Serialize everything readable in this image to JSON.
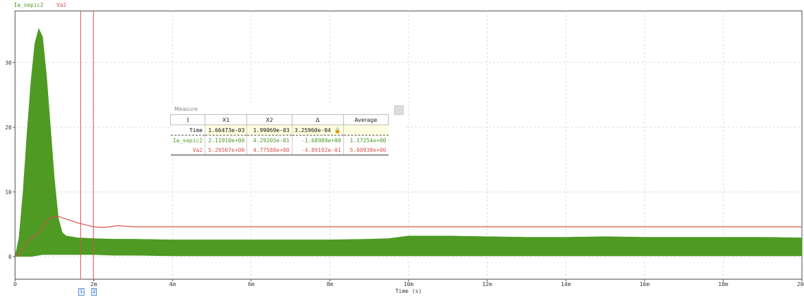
{
  "chart_data": {
    "type": "line",
    "xlabel": "Time (s)",
    "x_unit": "s",
    "xlim": [
      0,
      0.02
    ],
    "ylim": [
      -3.5,
      38
    ],
    "x_ticks": [
      0,
      0.002,
      0.004,
      0.006,
      0.008,
      0.01,
      0.012,
      0.014,
      0.016,
      0.018,
      0.02
    ],
    "x_tick_labels": [
      "0",
      "2m",
      "4m",
      "6m",
      "8m",
      "10m",
      "12m",
      "14m",
      "16m",
      "18m",
      "20m"
    ],
    "y_ticks": [
      0,
      10,
      20,
      30
    ],
    "y_tick_labels": [
      "0",
      "10",
      "20",
      "30"
    ],
    "grid": true,
    "legend_placement": "top-left",
    "series": [
      {
        "name": "Ia_sepic2",
        "color": "#4e9a23",
        "style": "high-frequency band (min/max envelope)",
        "x": [
          0,
          0.0001,
          0.0002,
          0.0003,
          0.0004,
          0.0005,
          0.0006,
          0.0007,
          0.0008,
          0.0009,
          0.001,
          0.0011,
          0.0012,
          0.0013,
          0.0016,
          0.002,
          0.0025,
          0.003,
          0.004,
          0.005,
          0.006,
          0.007,
          0.008,
          0.009,
          0.0095,
          0.01,
          0.011,
          0.012,
          0.013,
          0.014,
          0.015,
          0.016,
          0.017,
          0.018,
          0.019,
          0.02
        ],
        "upper": [
          0,
          3,
          10,
          19,
          27,
          33,
          35.3,
          34,
          28,
          20,
          12,
          6,
          3.7,
          3.2,
          2.9,
          2.8,
          2.7,
          2.7,
          2.6,
          2.6,
          2.6,
          2.6,
          2.6,
          2.7,
          2.8,
          3.2,
          3.2,
          3.1,
          3.0,
          3.0,
          3.1,
          3.0,
          3.0,
          3.0,
          3.0,
          2.9
        ],
        "lower": [
          0,
          0,
          0,
          0,
          0,
          0.1,
          0.2,
          0.3,
          0.3,
          0.3,
          0.3,
          0.3,
          0.3,
          0.3,
          0.3,
          0.3,
          0.2,
          0.2,
          0.1,
          0.1,
          0.1,
          0.1,
          0.1,
          0.1,
          0.1,
          0.1,
          0.1,
          0.1,
          0.1,
          0.1,
          0.1,
          0.1,
          0.1,
          0.1,
          0.1,
          0.1
        ]
      },
      {
        "name": "Va2",
        "color": "#d9534f",
        "x": [
          0,
          0.0001,
          0.0002,
          0.0003,
          0.0004,
          0.0005,
          0.0006,
          0.0007,
          0.0008,
          0.0009,
          0.001,
          0.0011,
          0.0012,
          0.0014,
          0.0016,
          0.0018,
          0.002,
          0.0022,
          0.0024,
          0.0026,
          0.0028,
          0.003,
          0.0035,
          0.004,
          0.006,
          0.008,
          0.01,
          0.012,
          0.014,
          0.016,
          0.018,
          0.02
        ],
        "y": [
          0,
          0.3,
          1.2,
          2.3,
          2.9,
          3.1,
          3.6,
          4.6,
          5.4,
          6.0,
          6.2,
          6.2,
          6.0,
          5.6,
          5.2,
          4.9,
          4.6,
          4.5,
          4.6,
          4.8,
          4.7,
          4.6,
          4.6,
          4.6,
          4.6,
          4.6,
          4.6,
          4.6,
          4.6,
          4.6,
          4.6,
          4.6
        ]
      }
    ],
    "cursors": [
      {
        "label": "1",
        "x": 0.00166473,
        "color": "#d9534f"
      },
      {
        "label": "2",
        "x": 0.00199069,
        "color": "#d9534f"
      }
    ]
  },
  "measure": {
    "title": "Measure",
    "menu_label": "⋮",
    "columns": [
      "X1",
      "X2",
      "Δ",
      "Average"
    ],
    "rows": [
      {
        "name": "Time",
        "color": "#111111",
        "values": [
          "1.66473e-03",
          "1.99069e-03",
          "3.25960e-04",
          ""
        ]
      },
      {
        "name": "Ia_sepic2",
        "color": "#4e9a23",
        "values": [
          "2.11910e+00",
          "4.29205e-01",
          "-1.68989e+00",
          "1.17254e+00"
        ]
      },
      {
        "name": "Va2",
        "color": "#d9534f",
        "values": [
          "5.26507e+00",
          "4.77588e+00",
          "-4.89192e-01",
          "5.00938e+00"
        ]
      }
    ]
  }
}
